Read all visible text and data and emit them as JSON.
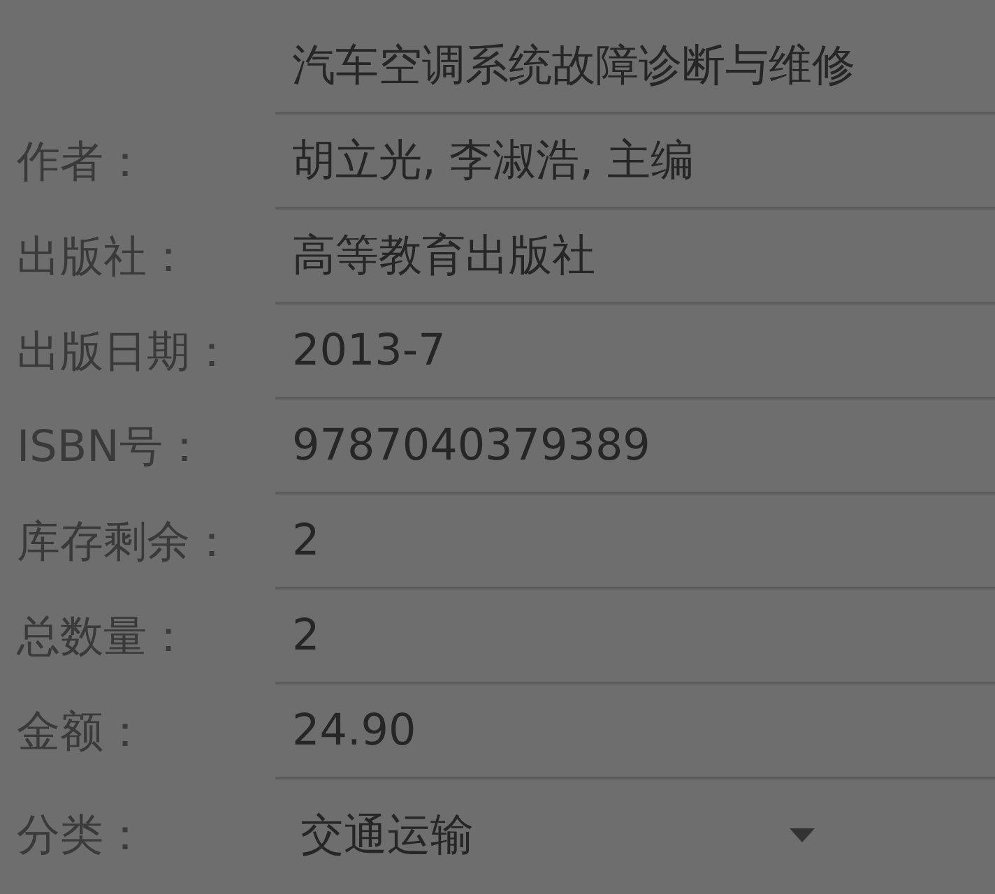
{
  "fields": [
    {
      "value": "汽车空调系统故障诊断与维修"
    },
    {
      "label": "作者：",
      "value": "胡立光, 李淑浩, 主编"
    },
    {
      "label": "出版社：",
      "value": "高等教育出版社"
    },
    {
      "label": "出版日期：",
      "value": "2013-7"
    },
    {
      "label": "ISBN号：",
      "value": "9787040379389"
    },
    {
      "label": "库存剩余：",
      "value": "2"
    },
    {
      "label": "总数量：",
      "value": "2"
    },
    {
      "label": "金额：",
      "value": "24.90"
    }
  ],
  "category": {
    "label": "分类：",
    "value": "交通运输"
  }
}
